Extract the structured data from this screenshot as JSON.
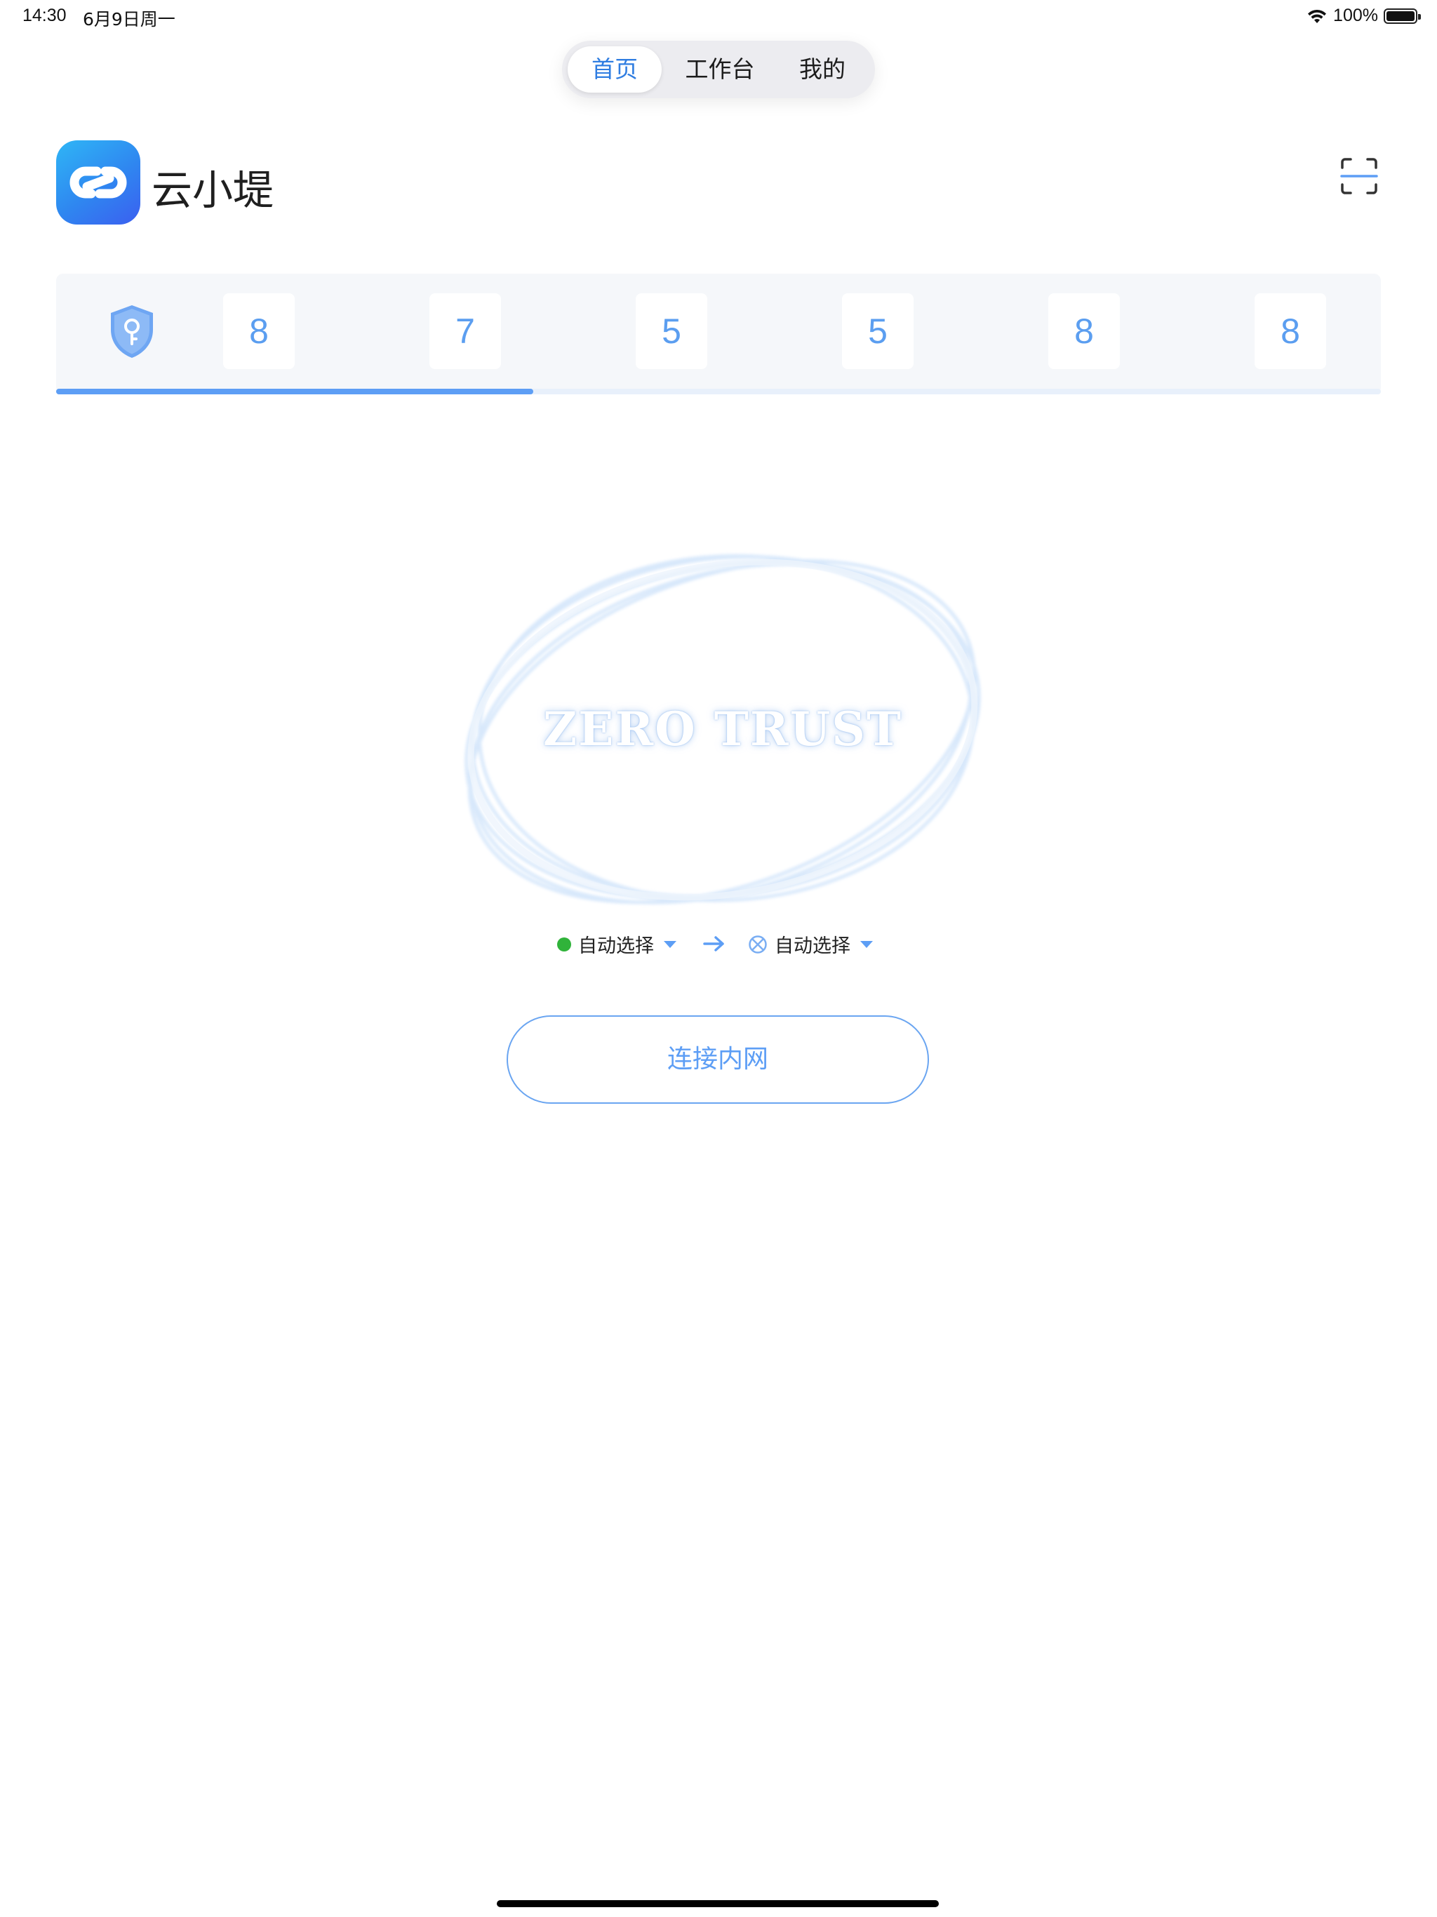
{
  "status_bar": {
    "time": "14:30",
    "date": "6月9日周一",
    "battery": "100%"
  },
  "tabs": [
    {
      "label": "首页",
      "active": true
    },
    {
      "label": "工作台",
      "active": false
    },
    {
      "label": "我的",
      "active": false
    }
  ],
  "header": {
    "app_name": "云小堤",
    "scan_icon": "scan-icon"
  },
  "otp": {
    "digits": [
      "8",
      "7",
      "5",
      "5",
      "8",
      "8"
    ],
    "progress": 0.36,
    "shield_icon": "shield-key-icon"
  },
  "hero": {
    "text": "ZERO TRUST"
  },
  "route": {
    "source_label": "自动选择",
    "target_label": "自动选择",
    "source_status_color": "#30b33a"
  },
  "connect_button": {
    "label": "连接内网"
  },
  "colors": {
    "accent": "#2f7de1",
    "digit": "#5b9ef0",
    "button_border": "#6aa5f1"
  }
}
